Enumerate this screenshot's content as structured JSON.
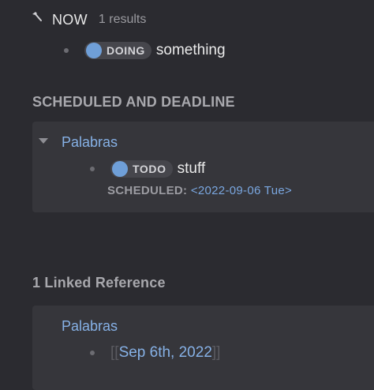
{
  "now": {
    "title": "NOW",
    "count": "1 results",
    "icon": "hammer-icon",
    "block": {
      "marker": "DOING",
      "text": "something",
      "marker_color": "#6f9fd8"
    }
  },
  "scheduled": {
    "heading": "SCHEDULED AND DEADLINE",
    "page": "Palabras",
    "block": {
      "marker": "TODO",
      "text": "stuff",
      "marker_color": "#6f9fd8"
    },
    "scheduled_label": "SCHEDULED:",
    "scheduled_date": "<2022-09-06 Tue>"
  },
  "linked": {
    "heading": "1 Linked Reference",
    "page": "Palabras",
    "block": {
      "open": "[[",
      "date": "Sep 6th, 2022",
      "close": "]]"
    }
  },
  "colors": {
    "background": "#2b2b30",
    "panel": "#36363b",
    "link": "#86b1e6",
    "marker": "#6f9fd8"
  }
}
